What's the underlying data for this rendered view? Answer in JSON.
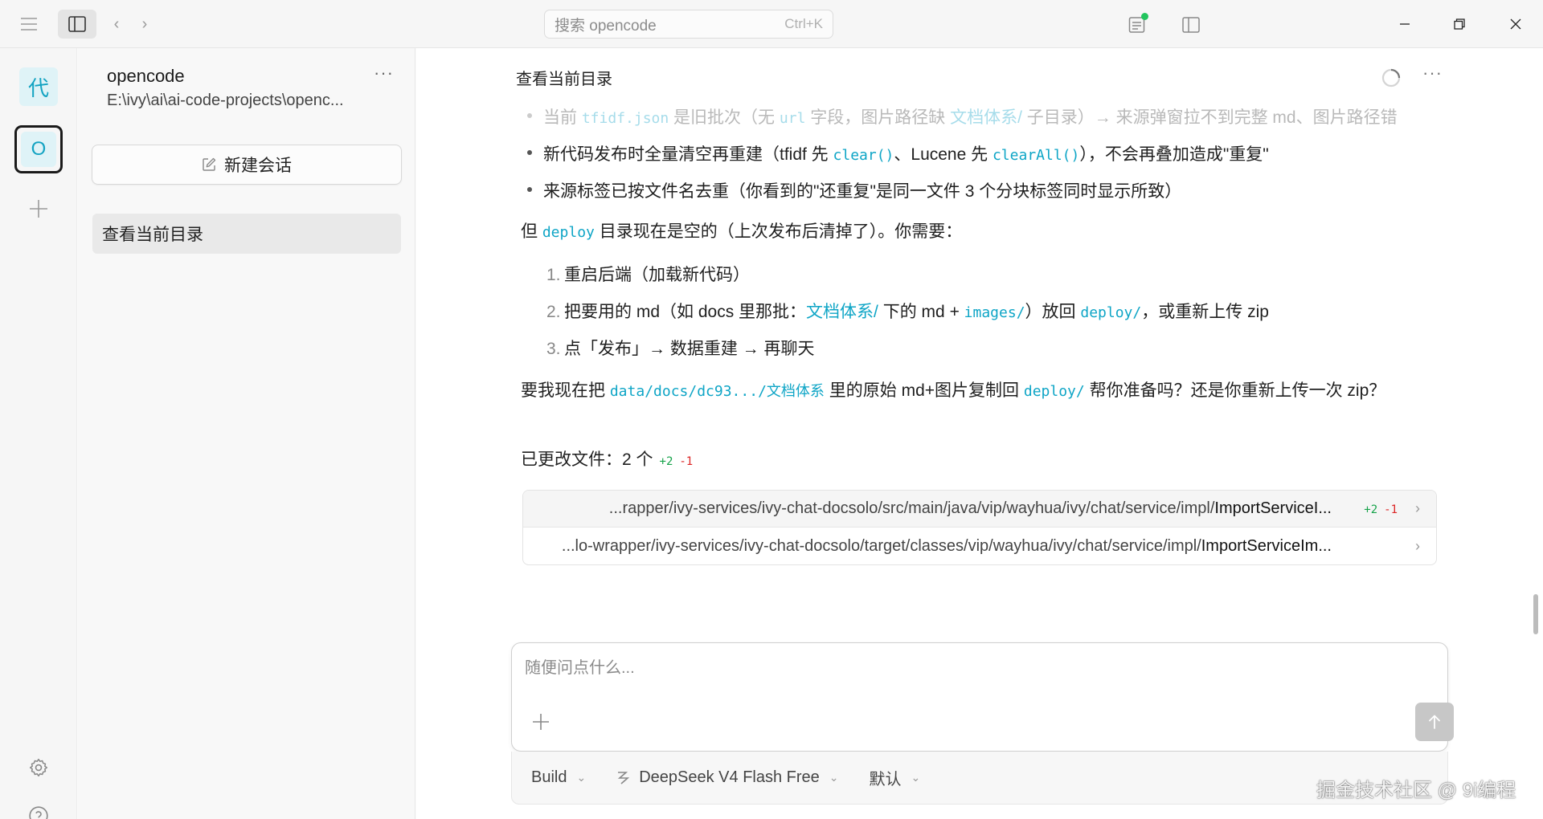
{
  "titlebar": {
    "search_placeholder": "搜索 opencode",
    "search_shortcut": "Ctrl+K"
  },
  "rail": {
    "project_avatar_text": "代",
    "active_project_text": "O"
  },
  "sessions": {
    "project_name": "opencode",
    "project_path": "E:\\ivy\\ai\\ai-code-projects\\openc...",
    "new_session_label": "新建会话",
    "items": [
      {
        "label": "查看当前目录"
      }
    ]
  },
  "conversation": {
    "title": "查看当前目录",
    "bullets": [
      {
        "p1": "当前 ",
        "c1": "tfidf.json",
        "p2": " 是旧批次（无 ",
        "c2": "url",
        "p3": " 字段，图片路径缺 ",
        "c3": "文档体系/",
        "p4": " 子目录）→ 来源弹窗拉不到完整 md、图片路径错"
      },
      {
        "p1": "新代码发布时全量清空再重建（tfidf 先 ",
        "c1": "clear()",
        "p2": "、Lucene 先 ",
        "c2": "clearAll()",
        "p3": "），不会再叠加造成\"重复\""
      },
      {
        "text": "来源标签已按文件名去重（你看到的\"还重复\"是同一文件 3 个分块标签同时显示所致）"
      }
    ],
    "para1": {
      "p1": "但 ",
      "c1": "deploy",
      "p2": " 目录现在是空的（上次发布后清掉了）。你需要："
    },
    "steps": [
      {
        "num": "1.",
        "text": "重启后端（加载新代码）"
      },
      {
        "num": "2.",
        "p1": "把要用的 md（如 docs 里那批：",
        "c1": "文档体系/",
        "p2": " 下的 md + ",
        "c2": "images/",
        "p3": "）放回 ",
        "c3": "deploy/",
        "p4": "，或重新上传 zip"
      },
      {
        "num": "3.",
        "text": "点「发布」→ 数据重建 → 再聊天"
      }
    ],
    "para2": {
      "p1": "要我现在把 ",
      "c1": "data/docs/dc93.../文档体系",
      "p2": " 里的原始 md+图片复制回 ",
      "c2": "deploy/",
      "p3": " 帮你准备吗？还是你重新上传一次 zip？"
    },
    "changed_files": {
      "label": "已更改文件：2 个",
      "add": "+2",
      "del": "-1"
    },
    "files": [
      {
        "dir": "...rapper/ivy-services/ivy-chat-docsolo/src/main/java/vip/wayhua/ivy/chat/service/impl/",
        "name": "ImportServiceI...",
        "add": "+2",
        "del": "-1"
      },
      {
        "dir": "...lo-wrapper/ivy-services/ivy-chat-docsolo/target/classes/vip/wayhua/ivy/chat/service/impl/",
        "name": "ImportServiceIm...",
        "add": "",
        "del": ""
      }
    ]
  },
  "composer": {
    "placeholder": "随便问点什么...",
    "agent": "Build",
    "model": "DeepSeek V4 Flash Free",
    "variant": "默认"
  },
  "watermark": "掘金技术社区 @ 9i编程",
  "colors": {
    "accent_cyan": "#0ea5c6",
    "status_green": "#22c55e",
    "diff_add": "#16a34a",
    "diff_del": "#dc2626"
  }
}
